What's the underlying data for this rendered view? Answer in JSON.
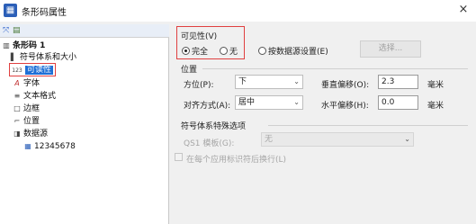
{
  "window": {
    "title": "条形码属性",
    "app_icon_glyph": "▦",
    "close_glyph": "×"
  },
  "tree": {
    "toolbar_icons": [
      "tree-expand-icon",
      "tree-view-icon"
    ],
    "toolbar_glyphs": [
      "⤧",
      "▤"
    ],
    "items": [
      {
        "icon": "barcode-icon",
        "glyph": "▥",
        "label": "条形码 1",
        "bold": true
      },
      {
        "icon": "barcode-lines-icon",
        "glyph": "▌",
        "label": "符号体系和大小"
      },
      {
        "icon": "number-icon",
        "glyph": "123",
        "label": "可读性",
        "selected": true
      },
      {
        "icon": "font-icon",
        "glyph": "A",
        "label": "字体"
      },
      {
        "icon": "text-format-icon",
        "glyph": "≡",
        "label": "文本格式"
      },
      {
        "icon": "border-icon",
        "glyph": "□",
        "label": "边框"
      },
      {
        "icon": "position-icon",
        "glyph": "⌐",
        "label": "位置"
      },
      {
        "icon": "datasource-icon",
        "glyph": "◨",
        "label": "数据源"
      },
      {
        "icon": "data-item-icon",
        "glyph": "▦",
        "label": "12345678"
      }
    ]
  },
  "visibility": {
    "title": "可见性(V)",
    "options": [
      {
        "label": "完全",
        "checked": true
      },
      {
        "label": "无",
        "checked": false
      },
      {
        "label": "按数据源设置(E)",
        "checked": false
      }
    ],
    "select_button": "选择..."
  },
  "position": {
    "title": "位置",
    "azimuth_label": "方位(P):",
    "azimuth_value": "下",
    "align_label": "对齐方式(A):",
    "align_value": "居中",
    "vertical_label": "垂直偏移(O):",
    "vertical_value": "2.3",
    "vertical_unit": "毫米",
    "horizontal_label": "水平偏移(H):",
    "horizontal_value": "0.0",
    "horizontal_unit": "毫米"
  },
  "symbology": {
    "title": "符号体系特殊选项",
    "qs1_label": "QS1 模板(G):",
    "qs1_value": "无",
    "checkbox_label": "在每个应用标识符后换行(L)"
  },
  "colors": {
    "accent": "#1f6fd6",
    "highlight_border": "#e04040"
  }
}
